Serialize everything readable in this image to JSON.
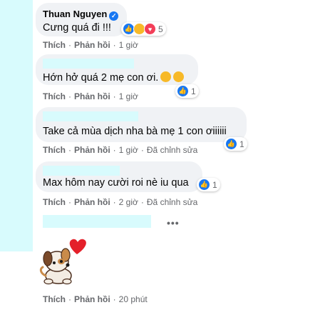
{
  "comments": [
    {
      "author": "Thuan Nguyen",
      "text": "Cưng quá đi !!!",
      "reactions": {
        "types": [
          "like",
          "care",
          "heart"
        ],
        "count": "5"
      },
      "actions": {
        "like": "Thích",
        "reply": "Phản hồi",
        "time": "1 giờ"
      }
    },
    {
      "text": "Hớn hở quá 2 mẹ con ơi.",
      "reactions": {
        "types": [
          "like"
        ],
        "count": "1"
      },
      "actions": {
        "like": "Thích",
        "reply": "Phản hồi",
        "time": "1 giờ"
      }
    },
    {
      "text": "Take cả mùa dịch nha bà mẹ 1 con ơiiiiii",
      "reactions": {
        "types": [
          "like"
        ],
        "count": "1"
      },
      "actions": {
        "like": "Thích",
        "reply": "Phản hồi",
        "time": "1 giờ",
        "edited": "Đã chỉnh sửa"
      }
    },
    {
      "text": "Max hôm nay cười roi nè iu qua",
      "reactions": {
        "types": [
          "like"
        ],
        "count": "1"
      },
      "actions": {
        "like": "Thích",
        "reply": "Phản hồi",
        "time": "2 giờ",
        "edited": "Đã chỉnh sửa"
      }
    },
    {
      "sticker": "puppy-heart-sticker",
      "actions": {
        "like": "Thích",
        "reply": "Phản hồi",
        "time": "20 phút"
      }
    }
  ],
  "more_options": "•••",
  "colors": {
    "bubble": "#f0f2f5",
    "redaction": "#d8fbfd",
    "like_blue": "#1877f2",
    "meta_gray": "#65676b"
  }
}
